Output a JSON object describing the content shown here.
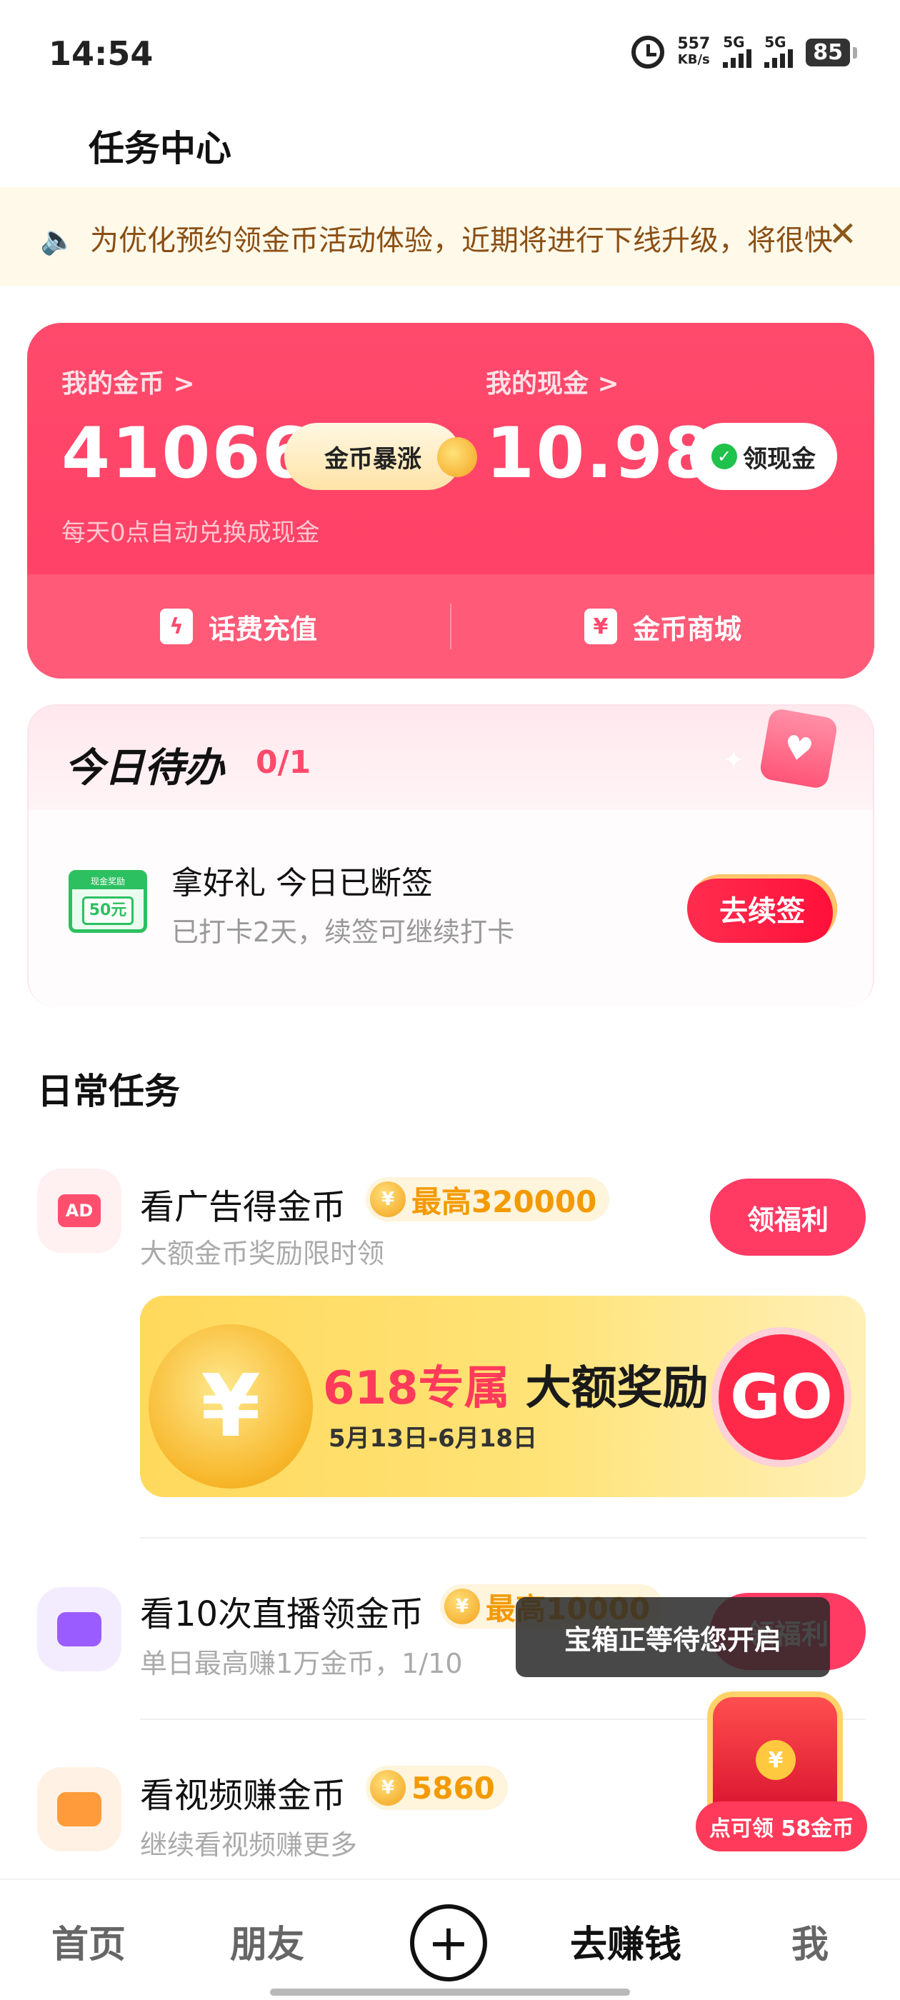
{
  "status_bar": {
    "time": "14:54",
    "speed_value": "557",
    "speed_unit": "KB/s",
    "net1": "5G",
    "net2": "5G",
    "battery": "85"
  },
  "header": {
    "title": "任务中心"
  },
  "notice": {
    "text": "为优化预约领金币活动体验，近期将进行下线升级，将很快",
    "icons": {
      "speaker": "speaker-icon",
      "close": "close-icon"
    }
  },
  "wallet": {
    "coins_label": "我的金币 >",
    "coins_value": "41066",
    "coins_button": "金币暴涨",
    "cash_label": "我的现金 >",
    "cash_value": "10.98",
    "cash_button": "领现金",
    "hint": "每天0点自动兑换成现金",
    "actions": [
      {
        "label": "话费充值",
        "icon": "lightning-icon"
      },
      {
        "label": "金币商城",
        "icon": "yen-ticket-icon"
      }
    ],
    "color": "#ff4a6c"
  },
  "todo": {
    "title": "今日待办",
    "count": "0/1",
    "item_title": "拿好礼 今日已断签",
    "item_sub": "已打卡2天，续签可继续打卡",
    "ticket_top": "现金奖励",
    "ticket_value": "50元",
    "button": "去续签"
  },
  "daily": {
    "title": "日常任务",
    "tasks": [
      {
        "name": "看广告得金币",
        "reward": "最高320000",
        "sub": "大额金币奖励限时领",
        "button": "领福利",
        "icon": "ad-icon"
      },
      {
        "name": "看10次直播领金币",
        "reward": "最高10000",
        "sub": "单日最高赚1万金币，1/10",
        "button": "领福利",
        "icon": "video-camera-icon"
      },
      {
        "name": "看视频赚金币",
        "reward": "5860",
        "sub": "继续看视频赚更多",
        "button": "",
        "icon": "video-icon"
      }
    ],
    "banner": {
      "red": "618专属",
      "black": "大额奖励",
      "dates": "5月13日-6月18日",
      "go": "GO"
    }
  },
  "tooltip": "宝箱正等待您开启",
  "chest": {
    "label": "点可领 58金币"
  },
  "nav": {
    "items": [
      "首页",
      "朋友",
      "去赚钱",
      "我"
    ],
    "plus": "+",
    "active": "去赚钱"
  }
}
